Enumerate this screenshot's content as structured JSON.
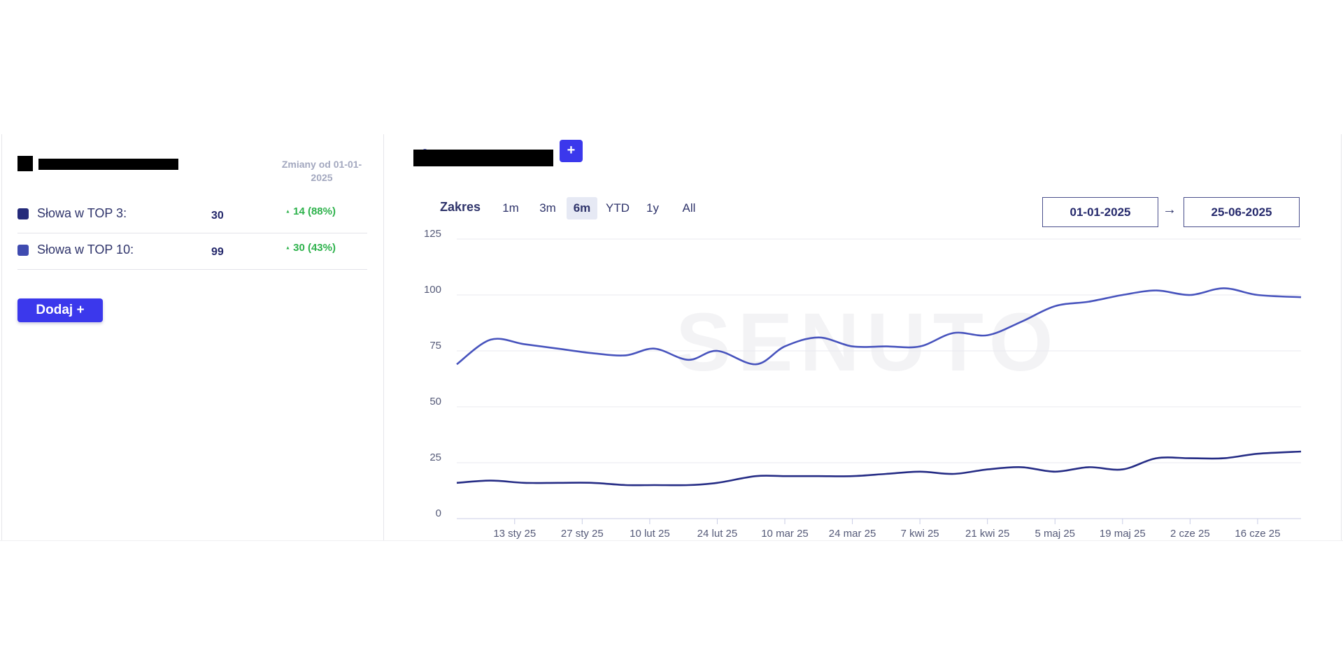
{
  "left_panel": {
    "changes_label": "Zmiany od 01-01-2025",
    "stats": [
      {
        "label": "Słowa w TOP 3:",
        "value": "30",
        "change": "14 (88%)",
        "swatch_color": "#242a7a"
      },
      {
        "label": "Słowa w TOP 10:",
        "value": "99",
        "change": "30 (43%)",
        "swatch_color": "#3f4bb0"
      }
    ],
    "add_button_label": "Dodaj +"
  },
  "right_panel": {
    "add_series_label": "+",
    "range": {
      "label": "Zakres",
      "options": [
        "1m",
        "3m",
        "6m",
        "YTD",
        "1y",
        "All"
      ],
      "active": "6m"
    },
    "date_from": "01-01-2025",
    "date_arrow": "→",
    "date_to": "25-06-2025",
    "watermark": "SENUTO"
  },
  "colors": {
    "accent": "#3b38ec",
    "positive": "#2eb24c",
    "top3_line": "#252c85",
    "top10_line": "#4753bd"
  },
  "chart_data": {
    "type": "line",
    "x_start": "2025-01-01",
    "x_end": "2025-06-25",
    "x_tick_labels": [
      "13 sty 25",
      "27 sty 25",
      "10 lut 25",
      "24 lut 25",
      "10 mar 25",
      "24 mar 25",
      "7 kwi 25",
      "21 kwi 25",
      "5 maj 25",
      "19 maj 25",
      "2 cze 25",
      "16 cze 25"
    ],
    "x_tick_dates": [
      "2025-01-13",
      "2025-01-27",
      "2025-02-10",
      "2025-02-24",
      "2025-03-10",
      "2025-03-24",
      "2025-04-07",
      "2025-04-21",
      "2025-05-05",
      "2025-05-19",
      "2025-06-02",
      "2025-06-16"
    ],
    "y_ticks": [
      0,
      25,
      50,
      75,
      100,
      125
    ],
    "ylim": [
      0,
      125
    ],
    "grid": true,
    "series": [
      {
        "color": "#4753bd",
        "points": [
          [
            "2025-01-01",
            69
          ],
          [
            "2025-01-08",
            80
          ],
          [
            "2025-01-15",
            78
          ],
          [
            "2025-01-22",
            76
          ],
          [
            "2025-01-29",
            74
          ],
          [
            "2025-02-05",
            73
          ],
          [
            "2025-02-11",
            76
          ],
          [
            "2025-02-18",
            71
          ],
          [
            "2025-02-24",
            75
          ],
          [
            "2025-03-04",
            69
          ],
          [
            "2025-03-10",
            77
          ],
          [
            "2025-03-17",
            81
          ],
          [
            "2025-03-24",
            77
          ],
          [
            "2025-03-31",
            77
          ],
          [
            "2025-04-07",
            77
          ],
          [
            "2025-04-14",
            83
          ],
          [
            "2025-04-21",
            82
          ],
          [
            "2025-04-28",
            88
          ],
          [
            "2025-05-05",
            95
          ],
          [
            "2025-05-12",
            97
          ],
          [
            "2025-05-19",
            100
          ],
          [
            "2025-05-26",
            102
          ],
          [
            "2025-06-02",
            100
          ],
          [
            "2025-06-09",
            103
          ],
          [
            "2025-06-16",
            100
          ],
          [
            "2025-06-25",
            99
          ]
        ]
      },
      {
        "color": "#252c85",
        "points": [
          [
            "2025-01-01",
            16
          ],
          [
            "2025-01-08",
            17
          ],
          [
            "2025-01-15",
            16
          ],
          [
            "2025-01-22",
            16
          ],
          [
            "2025-01-29",
            16
          ],
          [
            "2025-02-05",
            15
          ],
          [
            "2025-02-11",
            15
          ],
          [
            "2025-02-18",
            15
          ],
          [
            "2025-02-24",
            16
          ],
          [
            "2025-03-04",
            19
          ],
          [
            "2025-03-10",
            19
          ],
          [
            "2025-03-17",
            19
          ],
          [
            "2025-03-24",
            19
          ],
          [
            "2025-03-31",
            20
          ],
          [
            "2025-04-07",
            21
          ],
          [
            "2025-04-14",
            20
          ],
          [
            "2025-04-21",
            22
          ],
          [
            "2025-04-28",
            23
          ],
          [
            "2025-05-05",
            21
          ],
          [
            "2025-05-12",
            23
          ],
          [
            "2025-05-19",
            22
          ],
          [
            "2025-05-26",
            27
          ],
          [
            "2025-06-02",
            27
          ],
          [
            "2025-06-09",
            27
          ],
          [
            "2025-06-16",
            29
          ],
          [
            "2025-06-25",
            30
          ]
        ]
      }
    ]
  }
}
